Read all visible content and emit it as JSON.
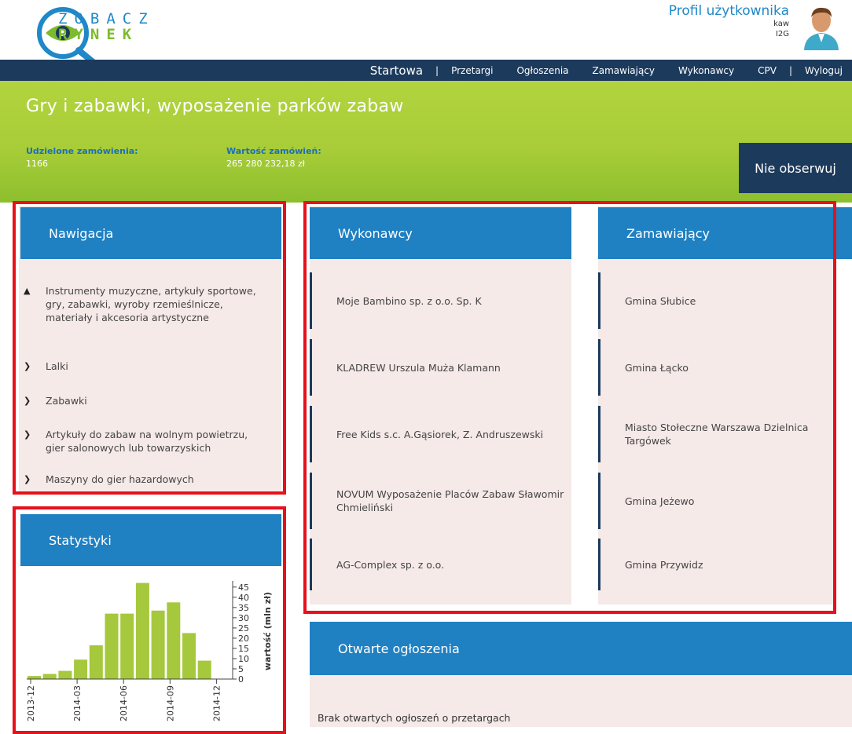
{
  "header": {
    "logo_line1": "ZOBACZ",
    "logo_line2": "RYNEK",
    "profile_title": "Profil użytkownika",
    "profile_user": "kaw",
    "profile_company": "I2G"
  },
  "navbar": {
    "items": [
      "Startowa",
      "|",
      "Przetargi",
      "Ogłoszenia",
      "Zamawiający",
      "Wykonawcy",
      "CPV",
      "|",
      "Wyloguj"
    ]
  },
  "banner": {
    "title": "Gry i zabawki, wyposażenie parków zabaw",
    "orders_label": "Udzielone zamówienia:",
    "orders_value": "1166",
    "value_label": "Wartość zamówień:",
    "value_value": "265 280 232,18 zł",
    "unwatch_label": "Nie obserwuj"
  },
  "navigation": {
    "title": "Nawigacja",
    "items": [
      {
        "label": "Instrumenty muzyczne, artykuły sportowe, gry, zabawki, wyroby rzemieślnicze, materiały i akcesoria artystyczne",
        "icon": "chevron-up-icon"
      },
      {
        "label": "Lalki",
        "icon": "chevron-right-icon"
      },
      {
        "label": "Zabawki",
        "icon": "chevron-right-icon"
      },
      {
        "label": "Artykuły do zabaw na wolnym powietrzu, gier salonowych lub towarzyskich",
        "icon": "chevron-right-icon"
      },
      {
        "label": "Maszyny do gier hazardowych",
        "icon": "chevron-right-icon"
      }
    ]
  },
  "contractors": {
    "title": "Wykonawcy",
    "items": [
      "Moje Bambino sp. z o.o. Sp. K",
      "KLADREW Urszula Muża Klamann",
      "Free Kids s.c. A.Gąsiorek, Z. Andruszewski",
      "NOVUM Wyposażenie Placów Zabaw Sławomir Chmieliński",
      "AG-Complex sp. z o.o."
    ]
  },
  "contracting": {
    "title": "Zamawiający",
    "items": [
      "Gmina Słubice",
      "Gmina Łącko",
      "Miasto Stołeczne Warszawa Dzielnica Targówek",
      "Gmina Jeżewo",
      "Gmina Przywidz"
    ]
  },
  "stats": {
    "title": "Statystyki"
  },
  "open_notices": {
    "title": "Otwarte ogłoszenia",
    "empty_text": "Brak otwartych ogłoszeń o przetargach"
  },
  "colors": {
    "accent_blue": "#1f80c2",
    "navy": "#1c3a5c",
    "banner_green": "#a8cd38",
    "bar_green": "#a6c83c",
    "highlight_red": "#e8101b",
    "panel_bg": "#f5eae8"
  },
  "chart_data": {
    "type": "bar",
    "x": [
      "2013-12",
      "2014-01",
      "2014-02",
      "2014-03",
      "2014-04",
      "2014-05",
      "2014-06",
      "2014-07",
      "2014-08",
      "2014-09",
      "2014-10",
      "2014-11"
    ],
    "values": [
      1.5,
      2.5,
      4,
      9.5,
      16.5,
      32,
      32,
      47,
      33.5,
      37.5,
      22.5,
      9
    ],
    "xticks": [
      "2013-12",
      "2014-03",
      "2014-06",
      "2014-09",
      "2014-12"
    ],
    "yticks": [
      0,
      5,
      10,
      15,
      20,
      25,
      30,
      35,
      40,
      45
    ],
    "ylabel": "wartość (mln zł)",
    "ylim": [
      0,
      48
    ]
  }
}
